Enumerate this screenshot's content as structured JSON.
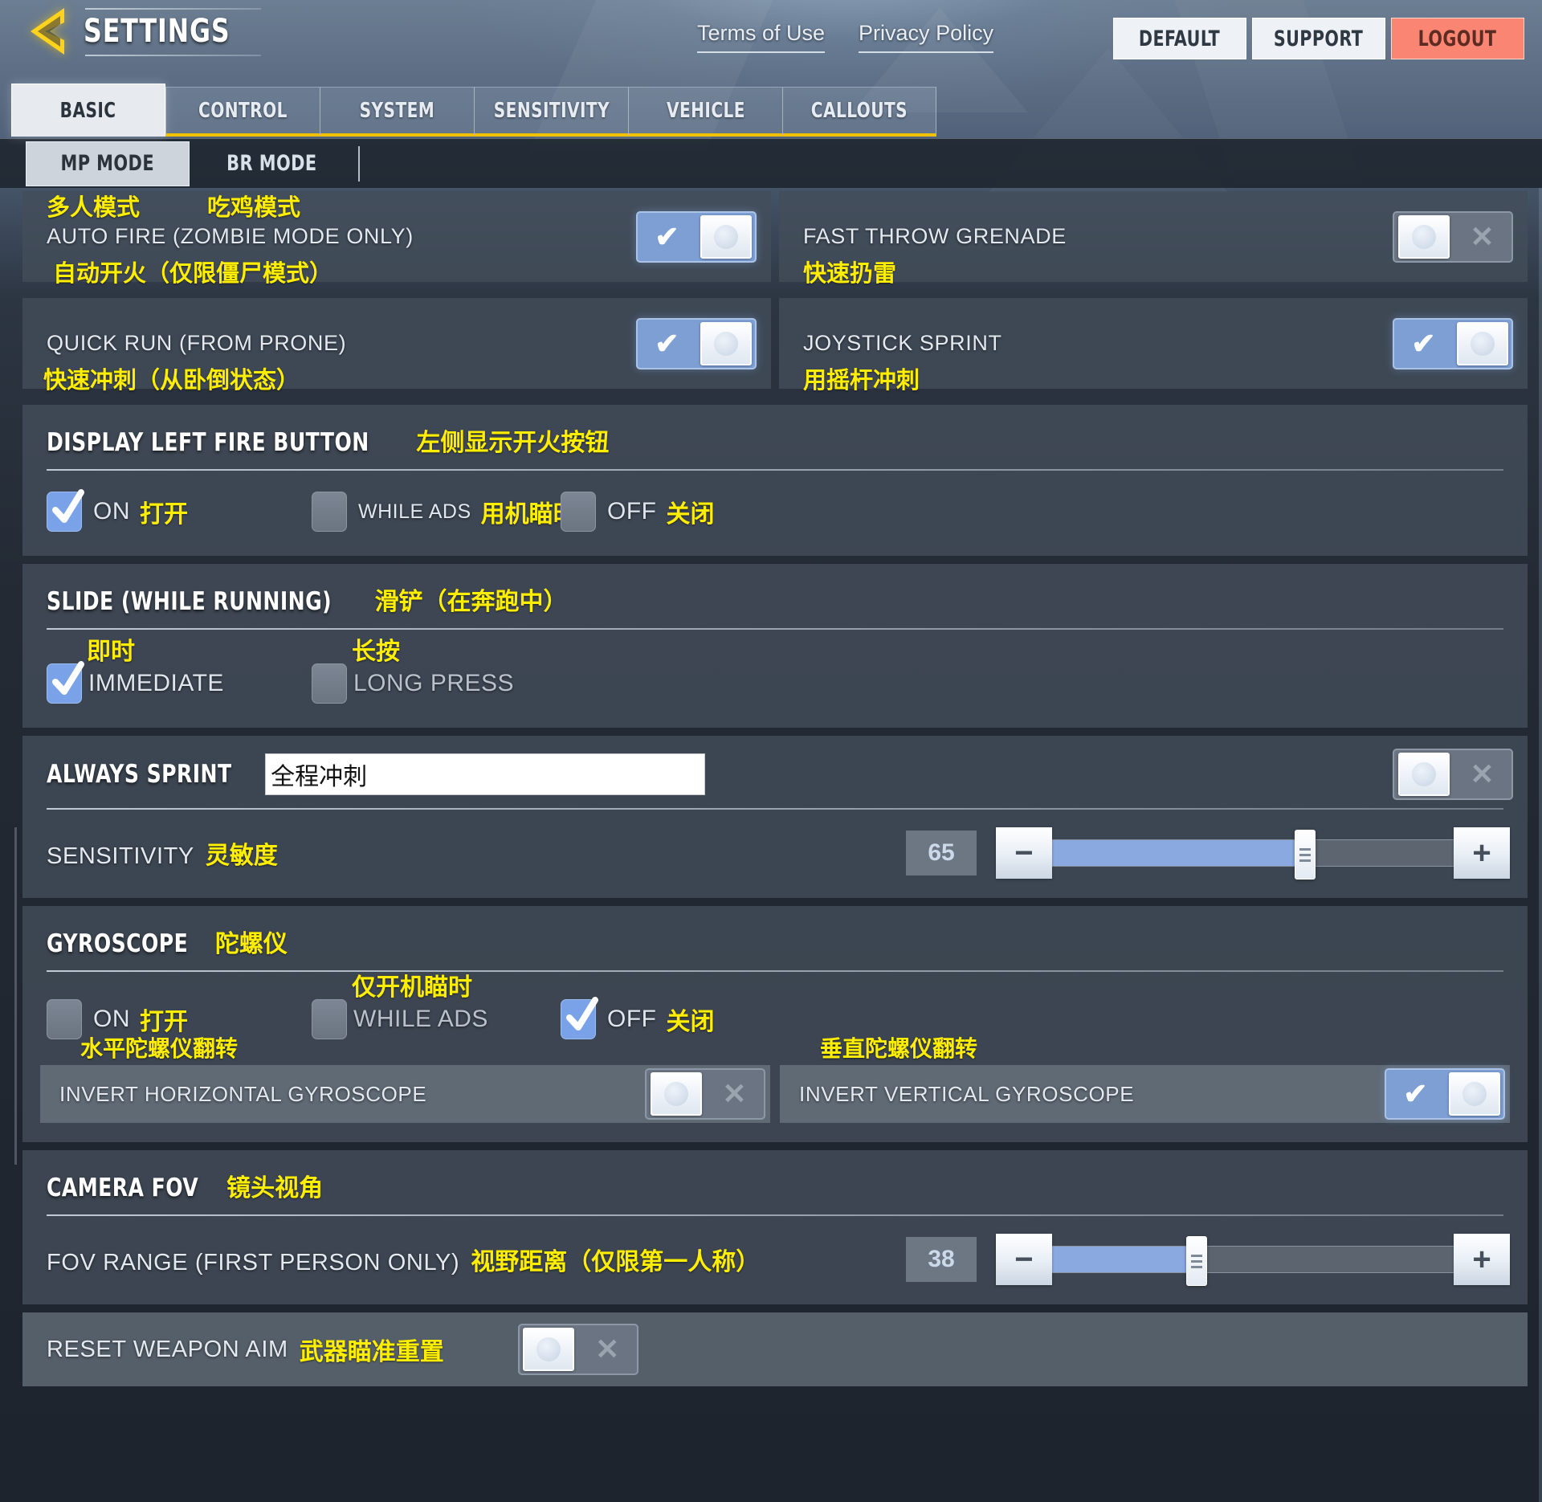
{
  "header": {
    "back_icon": "back-arrow-icon",
    "title": "SETTINGS",
    "links": [
      {
        "label": "Terms of Use"
      },
      {
        "label": "Privacy Policy"
      }
    ],
    "buttons": [
      {
        "label": "DEFAULT",
        "style": "light"
      },
      {
        "label": "SUPPORT",
        "style": "light"
      },
      {
        "label": "LOGOUT",
        "style": "danger",
        "color": "#fa8573"
      }
    ]
  },
  "tabs": [
    {
      "label": "BASIC",
      "active": true
    },
    {
      "label": "CONTROL",
      "active": false
    },
    {
      "label": "SYSTEM",
      "active": false
    },
    {
      "label": "SENSITIVITY",
      "active": false
    },
    {
      "label": "VEHICLE",
      "active": false
    },
    {
      "label": "CALLOUTS",
      "active": false
    }
  ],
  "mode_tabs": [
    {
      "label": "MP MODE",
      "annotation_cn": "多人模式",
      "active": true
    },
    {
      "label": "BR MODE",
      "annotation_cn": "吃鸡模式",
      "active": false
    }
  ],
  "toggles": [
    {
      "label": "AUTO FIRE (ZOMBIE MODE ONLY)",
      "annotation_cn": "自动开火（仅限僵尸模式）",
      "state": "on",
      "on_glyph": "✔",
      "off_glyph": "✕"
    },
    {
      "label": "FAST THROW GRENADE",
      "annotation_cn": "快速扔雷",
      "state": "off",
      "on_glyph": "✔",
      "off_glyph": "✕"
    },
    {
      "label": "QUICK RUN (FROM PRONE)",
      "annotation_cn": "快速冲刺（从卧倒状态）",
      "state": "on",
      "on_glyph": "✔",
      "off_glyph": "✕"
    },
    {
      "label": "JOYSTICK SPRINT",
      "annotation_cn": "用摇杆冲刺",
      "state": "on",
      "on_glyph": "✔",
      "off_glyph": "✕"
    }
  ],
  "display_left_fire": {
    "title": "DISPLAY LEFT FIRE BUTTON",
    "title_cn": "左侧显示开火按钮",
    "options": [
      {
        "label": "ON",
        "label_cn": "打开",
        "checked": true
      },
      {
        "label": "WHILE ADS",
        "label_cn": "用机瞄时",
        "checked": false
      },
      {
        "label": "OFF",
        "label_cn": "关闭",
        "checked": false
      }
    ]
  },
  "slide_while_running": {
    "title": "SLIDE (WHILE RUNNING)",
    "title_cn": "滑铲（在奔跑中）",
    "options": [
      {
        "label": "IMMEDIATE",
        "label_cn": "即时",
        "checked": true
      },
      {
        "label": "LONG PRESS",
        "label_cn": "长按",
        "checked": false
      }
    ]
  },
  "always_sprint": {
    "title": "ALWAYS SPRINT",
    "ime_value": "全程冲刺",
    "toggle_state": "off"
  },
  "sensitivity": {
    "label": "SENSITIVITY",
    "label_cn": "灵敏度",
    "value": "65",
    "fill_percent": 63,
    "minus": "−",
    "plus": "+"
  },
  "gyroscope": {
    "title": "GYROSCOPE",
    "title_cn": "陀螺仪",
    "options": [
      {
        "label": "ON",
        "label_cn": "打开",
        "checked": false
      },
      {
        "label": "WHILE ADS",
        "label_cn": "仅开机瞄时",
        "checked": false
      },
      {
        "label": "OFF",
        "label_cn": "关闭",
        "checked": true
      }
    ],
    "invert": [
      {
        "label": "INVERT HORIZONTAL GYROSCOPE",
        "label_cn": "水平陀螺仪翻转",
        "state": "off"
      },
      {
        "label": "INVERT VERTICAL GYROSCOPE",
        "label_cn": "垂直陀螺仪翻转",
        "state": "on"
      }
    ]
  },
  "camera_fov": {
    "title": "CAMERA FOV",
    "title_cn": "镜头视角",
    "label": "FOV RANGE (FIRST PERSON ONLY)",
    "label_cn": "视野距离（仅限第一人称）",
    "value": "38",
    "fill_percent": 36,
    "minus": "−",
    "plus": "+"
  },
  "reset_weapon_aim": {
    "label": "RESET WEAPON AIM",
    "label_cn": "武器瞄准重置",
    "state": "off"
  }
}
